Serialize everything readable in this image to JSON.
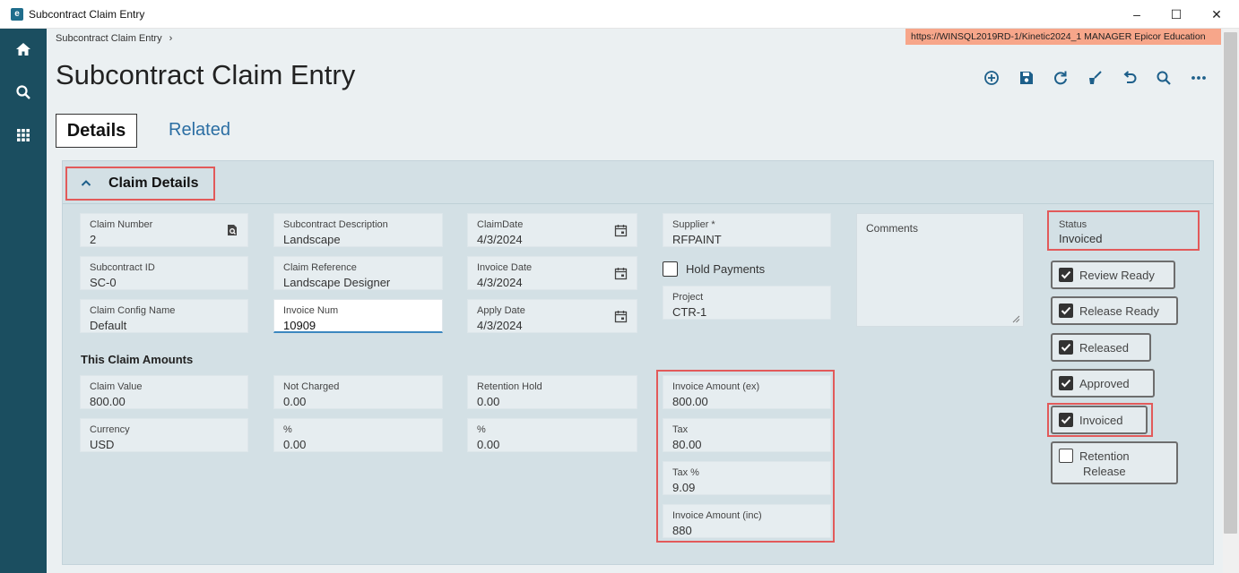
{
  "window": {
    "title": "Subcontract Claim Entry",
    "minimize": "–",
    "maximize": "☐",
    "close": "✕"
  },
  "breadcrumb": {
    "label": "Subcontract Claim Entry",
    "separator": "›"
  },
  "server_info": "https://WINSQL2019RD-1/Kinetic2024_1  MANAGER  Epicor Education",
  "page_title": "Subcontract Claim Entry",
  "toolbar_icons": [
    "add-icon",
    "save-icon",
    "refresh-icon",
    "clear-icon",
    "undo-icon",
    "search-icon",
    "more-icon"
  ],
  "tabs": {
    "details": "Details",
    "related": "Related"
  },
  "section": {
    "title": "Claim Details",
    "expanded": true
  },
  "fields": {
    "claim_number": {
      "label": "Claim Number",
      "value": "2"
    },
    "subcontract_description": {
      "label": "Subcontract Description",
      "value": "Landscape"
    },
    "claim_date": {
      "label": "ClaimDate",
      "value": "4/3/2024"
    },
    "supplier": {
      "label": "Supplier *",
      "value": "RFPAINT"
    },
    "subcontract_id": {
      "label": "Subcontract ID",
      "value": "SC-0"
    },
    "claim_reference": {
      "label": "Claim Reference",
      "value": "Landscape Designer"
    },
    "invoice_date": {
      "label": "Invoice Date",
      "value": "4/3/2024"
    },
    "claim_config_name": {
      "label": "Claim Config Name",
      "value": "Default"
    },
    "invoice_num": {
      "label": "Invoice Num",
      "value": "10909"
    },
    "apply_date": {
      "label": "Apply Date",
      "value": "4/3/2024"
    },
    "project": {
      "label": "Project",
      "value": "CTR-1"
    }
  },
  "hold_payments": {
    "label": "Hold Payments",
    "checked": false
  },
  "comments": {
    "label": "Comments"
  },
  "status": {
    "label": "Status",
    "value": "Invoiced"
  },
  "checkboxes": {
    "review_ready": {
      "label": "Review Ready",
      "checked": true
    },
    "release_ready": {
      "label": "Release Ready",
      "checked": true
    },
    "released": {
      "label": "Released",
      "checked": true
    },
    "approved": {
      "label": "Approved",
      "checked": true
    },
    "invoiced": {
      "label": "Invoiced",
      "checked": true
    },
    "retention_release": {
      "label_line1": "Retention",
      "label_line2": "Release",
      "checked": false
    }
  },
  "amounts": {
    "title": "This Claim Amounts",
    "claim_value": {
      "label": "Claim Value",
      "value": "800.00"
    },
    "not_charged": {
      "label": "Not Charged",
      "value": "0.00"
    },
    "retention_hold": {
      "label": "Retention Hold",
      "value": "0.00"
    },
    "currency": {
      "label": "Currency",
      "value": "USD"
    },
    "not_charged_pct": {
      "label": "%",
      "value": "0.00"
    },
    "retention_pct": {
      "label": "%",
      "value": "0.00"
    },
    "invoice_amount_ex": {
      "label": "Invoice Amount (ex)",
      "value": "800.00"
    },
    "tax": {
      "label": "Tax",
      "value": "80.00"
    },
    "tax_pct": {
      "label": "Tax %",
      "value": "9.09"
    },
    "invoice_amount_inc": {
      "label": "Invoice Amount (inc)",
      "value": "880"
    }
  },
  "colors": {
    "rail": "#1b4e60",
    "accent": "#2b6ea3",
    "highlight": "#e25a5a",
    "server_bar": "#f7a68a",
    "panel": "#d3e0e5"
  }
}
